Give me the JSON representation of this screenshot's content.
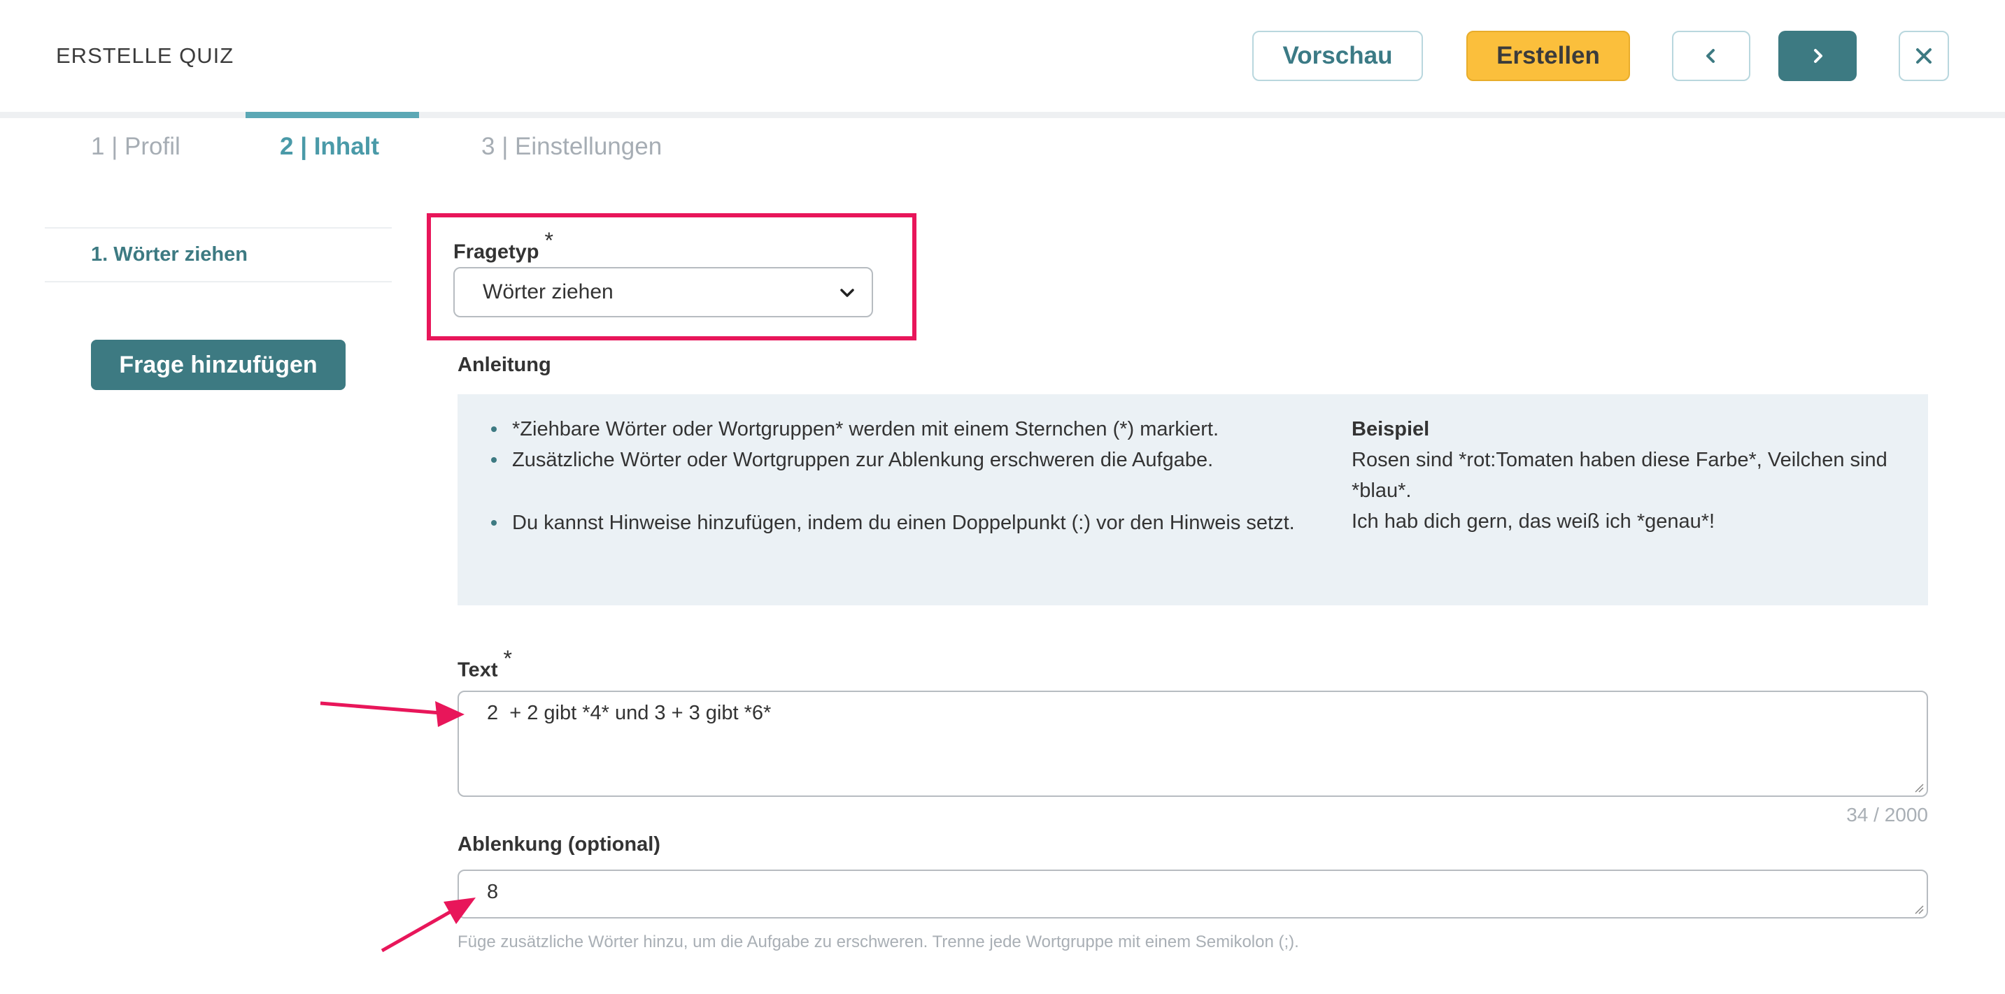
{
  "header": {
    "title": "ERSTELLE QUIZ",
    "preview_label": "Vorschau",
    "create_label": "Erstellen"
  },
  "tabs": [
    {
      "label": "1 | Profil"
    },
    {
      "label": "2 | Inhalt"
    },
    {
      "label": "3 | Einstellungen"
    }
  ],
  "sidebar": {
    "items": [
      {
        "label": "1. Wörter ziehen"
      }
    ],
    "add_question_label": "Frage hinzufügen"
  },
  "question_type": {
    "label": "Fragetyp",
    "required_mark": "*",
    "selected": "Wörter ziehen"
  },
  "instructions": {
    "label": "Anleitung",
    "bullets": [
      "*Ziehbare Wörter oder Wortgruppen* werden mit einem Sternchen (*) markiert.",
      "Zusätzliche Wörter oder Wortgruppen zur Ablenkung erschweren die Aufgabe.",
      "Du kannst Hinweise hinzufügen, indem du einen Doppelpunkt (:) vor den Hinweis setzt."
    ],
    "example_title": "Beispiel",
    "example_lines": [
      "Rosen sind *rot:Tomaten haben diese Farbe*, Veilchen sind *blau*.",
      "Ich hab dich gern, das weiß ich *genau*!"
    ]
  },
  "text_field": {
    "label": "Text",
    "required_mark": "*",
    "value": "2  + 2 gibt *4* und 3 + 3 gibt *6*",
    "counter": "34 / 2000"
  },
  "distraction_field": {
    "label": "Ablenkung (optional)",
    "value": "8",
    "hint": "Füge zusätzliche Wörter hinzu, um die Aufgabe zu erschweren. Trenne jede Wortgruppe mit einem Semikolon (;)."
  },
  "colors": {
    "accent": "#3d7a82",
    "create": "#fbbf3c",
    "highlight": "#e8165a",
    "tab_active": "#4a9aa8"
  }
}
